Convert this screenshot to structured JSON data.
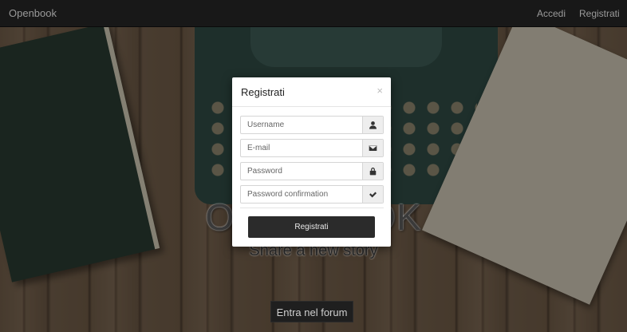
{
  "navbar": {
    "brand": "Openbook",
    "links": [
      {
        "label": "Accedi"
      },
      {
        "label": "Registrati"
      }
    ]
  },
  "hero": {
    "title": "OPENBOOK",
    "subtitle": "Share a new story",
    "cta": "Entra nel forum"
  },
  "modal": {
    "title": "Registrati",
    "close": "×",
    "fields": [
      {
        "placeholder": "Username",
        "icon": "user-icon"
      },
      {
        "placeholder": "E-mail",
        "icon": "envelope-icon"
      },
      {
        "placeholder": "Password",
        "icon": "lock-icon"
      },
      {
        "placeholder": "Password confirmation",
        "icon": "check-icon"
      }
    ],
    "submit": "Registrati"
  }
}
